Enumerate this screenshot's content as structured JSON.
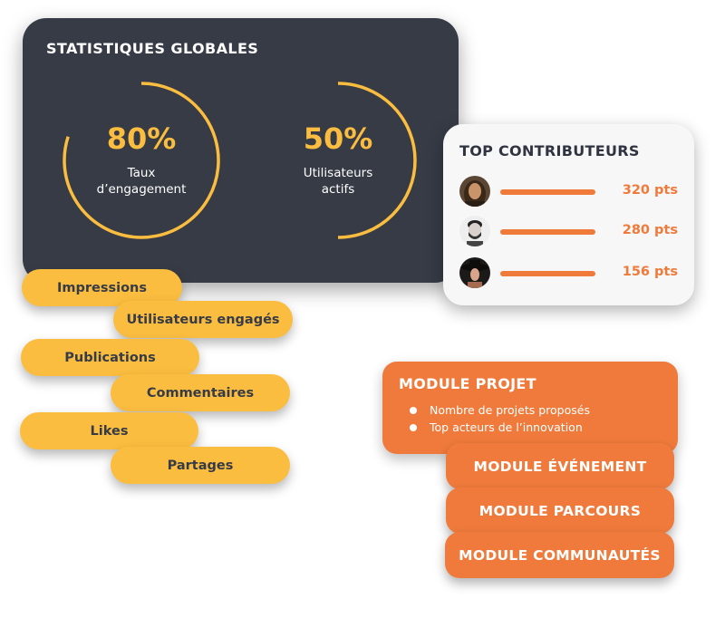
{
  "stats": {
    "title": "STATISTIQUES GLOBALES",
    "gauges": [
      {
        "value_label": "80%",
        "percent": 80,
        "label_line1": "Taux",
        "label_line2": "d’engagement"
      },
      {
        "value_label": "50%",
        "percent": 50,
        "label_line1": "Utilisateurs",
        "label_line2": "actifs"
      }
    ]
  },
  "contributors": {
    "title": "TOP CONTRIBUTEURS",
    "items": [
      {
        "avatar": "avatar-woman-long-hair",
        "score": 320,
        "score_label": "320 pts"
      },
      {
        "avatar": "avatar-man-beard",
        "score": 280,
        "score_label": "280 pts"
      },
      {
        "avatar": "avatar-woman-hat",
        "score": 156,
        "score_label": "156 pts"
      }
    ]
  },
  "metrics": [
    "Impressions",
    "Utilisateurs engagés",
    "Publications",
    "Commentaires",
    "Likes",
    "Partages"
  ],
  "modules": {
    "projet": {
      "title": "MODULE PROJET",
      "bullets": [
        "Nombre de projets proposés",
        "Top acteurs de l’innovation"
      ]
    },
    "others": [
      "MODULE ÉVÉNEMENT",
      "MODULE PARCOURS",
      "MODULE COMMUNAUTÉS"
    ]
  },
  "colors": {
    "dark": "#363b46",
    "yellow": "#fbbd3f",
    "orange": "#ef7a3b",
    "light_card": "#f7f7f7"
  }
}
